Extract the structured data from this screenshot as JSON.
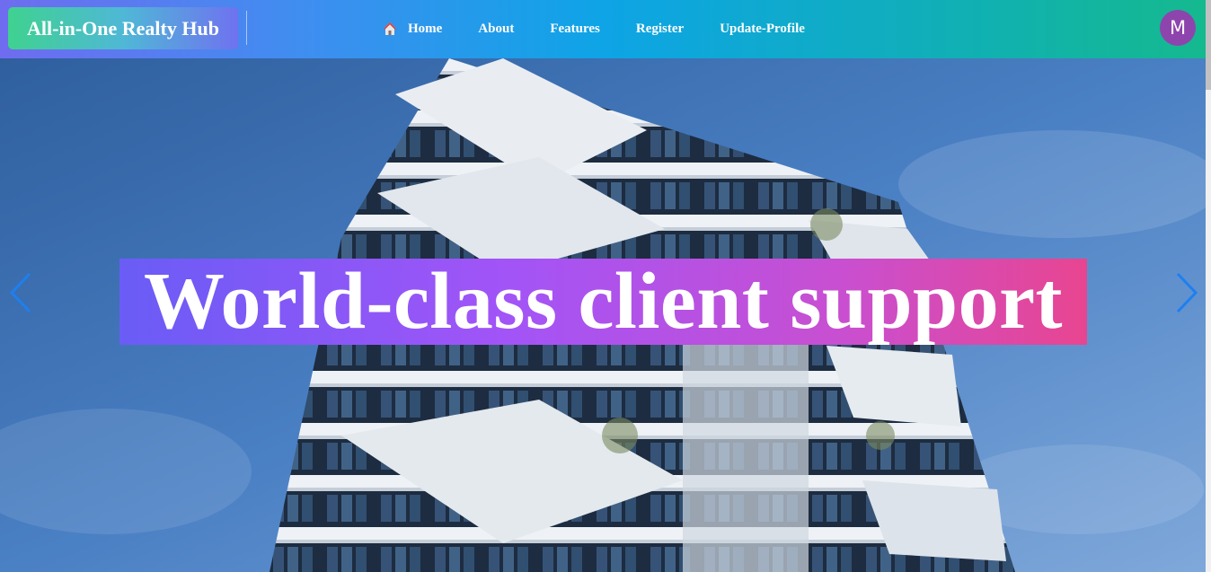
{
  "brand": {
    "name": "All-in-One Realty Hub"
  },
  "nav": {
    "items": [
      {
        "label": "Home",
        "icon": "home-icon"
      },
      {
        "label": "About"
      },
      {
        "label": "Features"
      },
      {
        "label": "Register"
      },
      {
        "label": "Update-Profile"
      }
    ]
  },
  "user": {
    "avatar_initial": "M",
    "avatar_color": "#8e44ad"
  },
  "hero": {
    "headline": "World-class client support",
    "prev_icon": "chevron-left-icon",
    "next_icon": "chevron-right-icon",
    "arrow_color": "#1e7ff0"
  }
}
